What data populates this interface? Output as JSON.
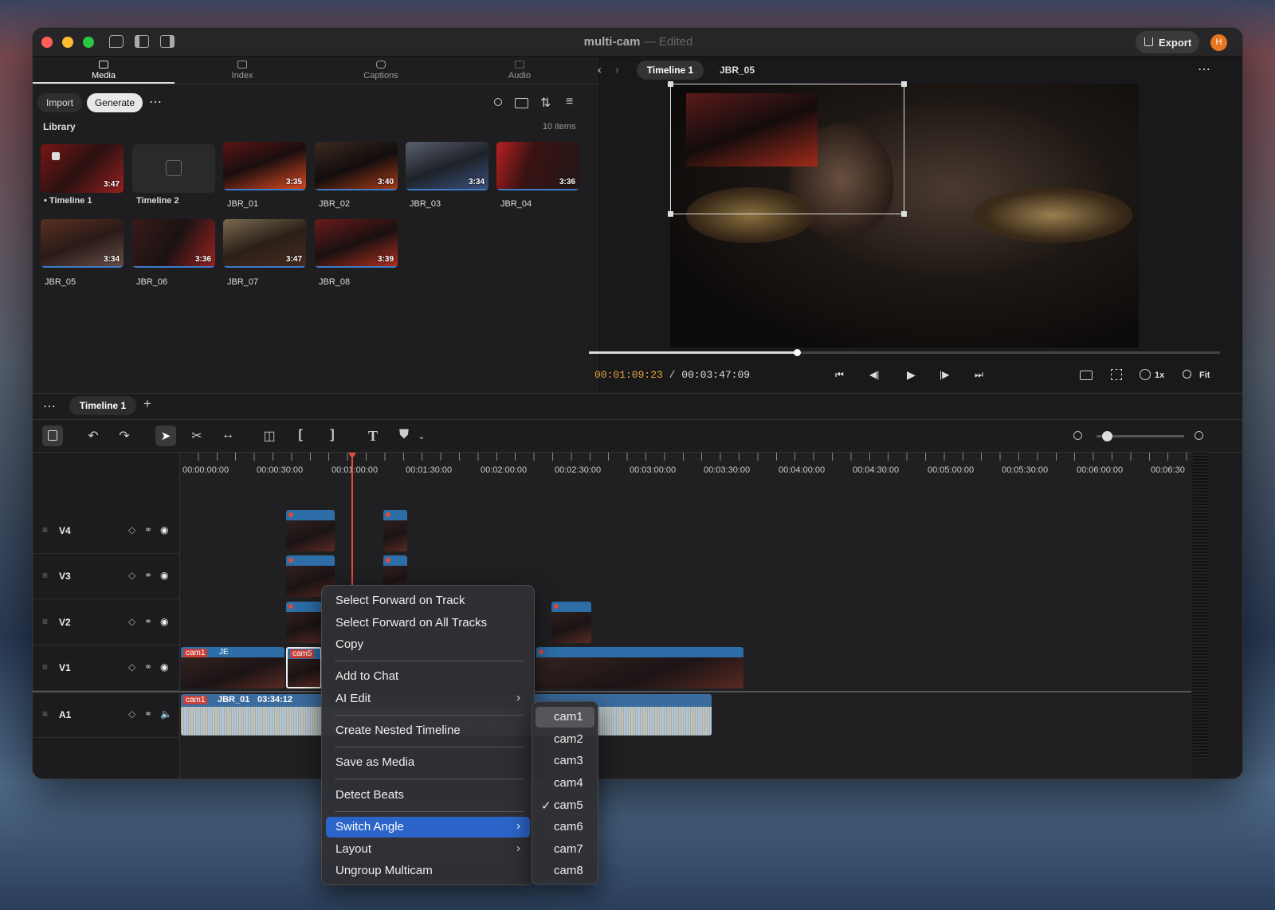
{
  "window": {
    "title": "multi-cam",
    "title_sep": "—",
    "status": "Edited",
    "export_label": "Export",
    "avatar_initial": "H"
  },
  "colors": {
    "accent": "#2c65c9",
    "playhead": "#e14b3b",
    "timecode": "#e8a23c",
    "clip_header": "#2d6ea8",
    "cam_tag": "#c8413a"
  },
  "left_tabs": [
    {
      "label": "Media",
      "icon": "media-icon",
      "active": true
    },
    {
      "label": "Index",
      "icon": "index-icon"
    },
    {
      "label": "Captions",
      "icon": "captions-icon"
    },
    {
      "label": "Audio",
      "icon": "audio-icon"
    }
  ],
  "library_toolbar": {
    "import_label": "Import",
    "generate_label": "Generate",
    "more": "⋯",
    "icons": [
      "search-icon",
      "folder-icon",
      "sort-icon",
      "filter-icon"
    ]
  },
  "library": {
    "heading": "Library",
    "count": "10 items",
    "items": [
      {
        "name": "Timeline 1",
        "duration": "3:47",
        "active": true
      },
      {
        "name": "Timeline 2",
        "duration": ""
      },
      {
        "name": "JBR_01",
        "duration": "3:35"
      },
      {
        "name": "JBR_02",
        "duration": "3:40"
      },
      {
        "name": "JBR_03",
        "duration": "3:34"
      },
      {
        "name": "JBR_04",
        "duration": "3:36"
      },
      {
        "name": "JBR_05",
        "duration": "3:34"
      },
      {
        "name": "JBR_06",
        "duration": "3:36"
      },
      {
        "name": "JBR_07",
        "duration": "3:47"
      },
      {
        "name": "JBR_08",
        "duration": "3:39"
      }
    ]
  },
  "viewer": {
    "tabs": [
      "Timeline 1",
      "JBR_05"
    ],
    "current_time": "00:01:09:23",
    "separator": "/",
    "total_time": "00:03:47:09",
    "progress": 0.33,
    "speed": "1x",
    "zoom": "Fit"
  },
  "timeline": {
    "tab_label": "Timeline 1",
    "add_tab": "+",
    "more": "⋯",
    "zoom_level": 0.06,
    "ruler": [
      "00:00:00:00",
      "00:00:30:00",
      "00:01:00:00",
      "00:01:30:00",
      "00:02:00:00",
      "00:02:30:00",
      "00:03:00:00",
      "00:03:30:00",
      "00:04:00:00",
      "00:04:30:00",
      "00:05:00:00",
      "00:05:30:00",
      "00:06:00:00",
      "00:06:30"
    ],
    "tracks": [
      {
        "name": "V4"
      },
      {
        "name": "V3"
      },
      {
        "name": "V2"
      },
      {
        "name": "V1"
      },
      {
        "name": "A1"
      }
    ],
    "v1_labels": {
      "cam1": "cam1",
      "cam1_clip": "JE",
      "cam5": "cam5"
    },
    "a1_labels": {
      "cam": "cam1",
      "clip": "JBR_01",
      "duration": "03:34:12"
    }
  },
  "context_menu": {
    "groups": [
      [
        {
          "label": "Select Forward on Track"
        },
        {
          "label": "Select Forward on All Tracks"
        },
        {
          "label": "Copy"
        }
      ],
      [
        {
          "label": "Add to Chat"
        },
        {
          "label": "AI Edit",
          "submenu": true
        }
      ],
      [
        {
          "label": "Create Nested Timeline"
        }
      ],
      [
        {
          "label": "Save as Media"
        }
      ],
      [
        {
          "label": "Detect Beats"
        }
      ],
      [
        {
          "label": "Switch Angle",
          "submenu": true,
          "selected": true
        },
        {
          "label": "Layout",
          "submenu": true
        },
        {
          "label": "Ungroup Multicam"
        }
      ]
    ],
    "submenu_arrow": "›"
  },
  "angle_submenu": {
    "items": [
      "cam1",
      "cam2",
      "cam3",
      "cam4",
      "cam5",
      "cam6",
      "cam7",
      "cam8"
    ],
    "checked": "cam5",
    "hovered": "cam1",
    "check_glyph": "✓"
  }
}
